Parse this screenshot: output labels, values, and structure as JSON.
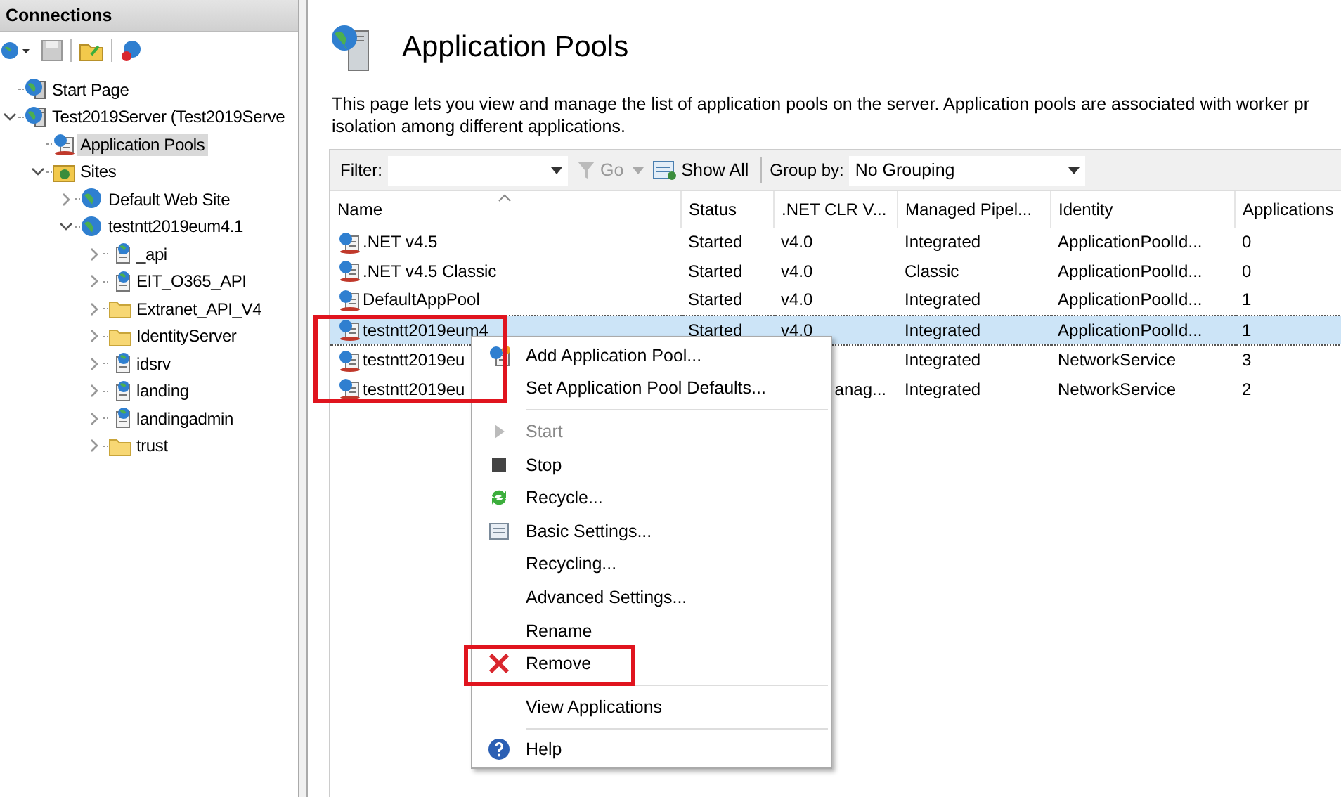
{
  "connections": {
    "title": "Connections",
    "tree": [
      {
        "label": "Start Page",
        "kind": "page"
      },
      {
        "label": "Test2019Server (Test2019Serve",
        "kind": "server",
        "expanded": true,
        "selected": false,
        "children": [
          {
            "label": "Application Pools",
            "kind": "pools",
            "selected": true
          },
          {
            "label": "Sites",
            "kind": "sites",
            "expanded": true,
            "selected": false,
            "children": [
              {
                "label": "Default Web Site",
                "kind": "site",
                "expanded": false,
                "selected": false
              },
              {
                "label": "testntt2019eum4.1",
                "kind": "site",
                "expanded": true,
                "selected": false,
                "children": [
                  {
                    "label": "_api",
                    "kind": "app",
                    "expanded": false,
                    "selected": false
                  },
                  {
                    "label": "EIT_O365_API",
                    "kind": "app",
                    "expanded": false,
                    "selected": false
                  },
                  {
                    "label": "Extranet_API_V4",
                    "kind": "folder",
                    "expanded": false,
                    "selected": false
                  },
                  {
                    "label": "IdentityServer",
                    "kind": "folder",
                    "expanded": false,
                    "selected": false
                  },
                  {
                    "label": "idsrv",
                    "kind": "app",
                    "expanded": false,
                    "selected": false
                  },
                  {
                    "label": "landing",
                    "kind": "app",
                    "expanded": false,
                    "selected": false
                  },
                  {
                    "label": "landingadmin",
                    "kind": "app",
                    "expanded": false,
                    "selected": false
                  },
                  {
                    "label": "trust",
                    "kind": "folder",
                    "expanded": false,
                    "selected": false
                  }
                ]
              }
            ]
          }
        ]
      }
    ]
  },
  "page": {
    "title": "Application Pools",
    "description": "This page lets you view and manage the list of application pools on the server. Application pools are associated with worker pr isolation among different applications."
  },
  "toolbar": {
    "filter_label": "Filter:",
    "go": "Go",
    "show_all": "Show All",
    "group_label": "Group by:",
    "group_value": "No Grouping"
  },
  "table": {
    "columns": [
      "Name",
      "Status",
      ".NET CLR V...",
      "Managed Pipel...",
      "Identity",
      "Applications"
    ],
    "names_framed": true,
    "rows": [
      {
        "name": ".NET v4.5",
        "status": "Started",
        "clr": "v4.0",
        "pipeline": "Integrated",
        "identity": "ApplicationPoolId...",
        "applications": "0",
        "selected": false
      },
      {
        "name": ".NET v4.5 Classic",
        "status": "Started",
        "clr": "v4.0",
        "pipeline": "Classic",
        "identity": "ApplicationPoolId...",
        "applications": "0",
        "selected": false
      },
      {
        "name": "DefaultAppPool",
        "status": "Started",
        "clr": "v4.0",
        "pipeline": "Integrated",
        "identity": "ApplicationPoolId...",
        "applications": "1",
        "selected": false
      },
      {
        "name": "testntt2019eum4",
        "status": "Started",
        "clr": "v4.0",
        "pipeline": "Integrated",
        "identity": "ApplicationPoolId...",
        "applications": "1",
        "selected": true
      },
      {
        "name": "testntt2019eu",
        "pipeline": "Integrated",
        "identity": "NetworkService",
        "applications": "3",
        "selected": false
      },
      {
        "name": "testntt2019eu",
        "clr": "anag...",
        "covered": true,
        "pipeline": "Integrated",
        "identity": "NetworkService",
        "applications": "2",
        "selected": false
      }
    ]
  },
  "context_menu": [
    {
      "kind": "item",
      "label": "Add Application Pool...",
      "disabled": false,
      "framed": false
    },
    {
      "kind": "item",
      "label": "Set Application Pool Defaults...",
      "disabled": false,
      "framed": false
    },
    {
      "kind": "separator"
    },
    {
      "kind": "item",
      "label": "Start",
      "disabled": true,
      "framed": false
    },
    {
      "kind": "item",
      "label": "Stop",
      "disabled": false,
      "framed": false
    },
    {
      "kind": "item",
      "label": "Recycle...",
      "disabled": false,
      "framed": false
    },
    {
      "kind": "item",
      "label": "Basic Settings...",
      "disabled": false,
      "framed": false
    },
    {
      "kind": "item",
      "label": "Recycling...",
      "disabled": false,
      "framed": false
    },
    {
      "kind": "item",
      "label": "Advanced Settings...",
      "disabled": false,
      "framed": false
    },
    {
      "kind": "item",
      "label": "Rename",
      "disabled": false,
      "framed": false
    },
    {
      "kind": "item",
      "label": "Remove",
      "disabled": false,
      "framed": true
    },
    {
      "kind": "separator"
    },
    {
      "kind": "item",
      "label": "View Applications",
      "disabled": false,
      "framed": false
    },
    {
      "kind": "separator"
    },
    {
      "kind": "item",
      "label": "Help",
      "disabled": false,
      "framed": false
    }
  ]
}
